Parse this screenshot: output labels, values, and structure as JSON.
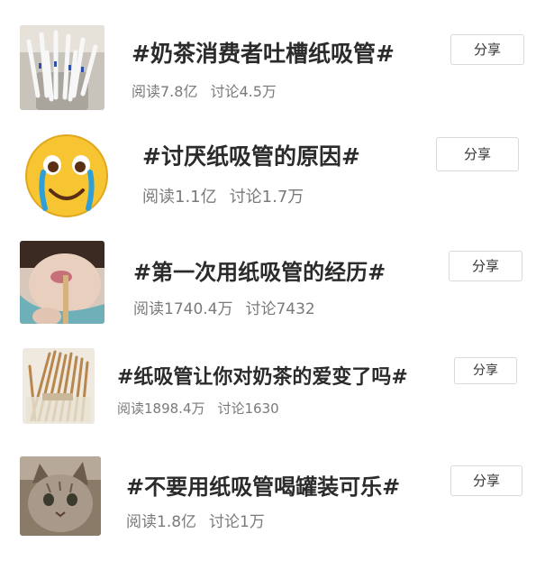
{
  "topics": [
    {
      "title": "#奶茶消费者吐槽纸吸管#",
      "reads": "阅读7.8亿",
      "discussions": "讨论4.5万",
      "share_label": "分享",
      "thumbnail": "paper-straws-in-cup"
    },
    {
      "title": "#讨厌纸吸管的原因#",
      "reads": "阅读1.1亿",
      "discussions": "讨论1.7万",
      "share_label": "分享",
      "thumbnail": "crying-emoji"
    },
    {
      "title": "#第一次用纸吸管的经历#",
      "reads": "阅读1740.4万",
      "discussions": "讨论7432",
      "share_label": "分享",
      "thumbnail": "person-drinking-with-straw"
    },
    {
      "title": "#纸吸管让你对奶茶的爱变了吗#",
      "reads": "阅读1898.4万",
      "discussions": "讨论1630",
      "share_label": "分享",
      "thumbnail": "bundle-of-paper-straws"
    },
    {
      "title": "#不要用纸吸管喝罐装可乐#",
      "reads": "阅读1.8亿",
      "discussions": "讨论1万",
      "share_label": "分享",
      "thumbnail": "cat-photo"
    }
  ]
}
